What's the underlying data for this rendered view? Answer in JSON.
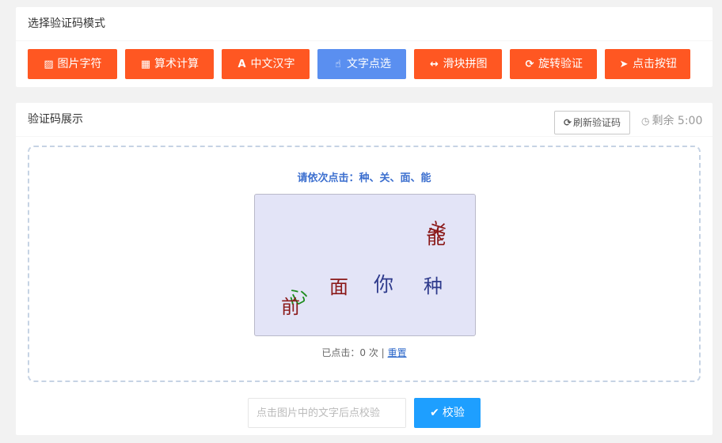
{
  "mode_card": {
    "title": "选择验证码模式",
    "buttons": [
      {
        "label": "图片字符",
        "icon": "image-icon",
        "glyph": "▨",
        "active": false
      },
      {
        "label": "算术计算",
        "icon": "calculator-icon",
        "glyph": "▦",
        "active": false
      },
      {
        "label": "中文汉字",
        "icon": "font-icon",
        "glyph": "A",
        "active": false
      },
      {
        "label": "文字点选",
        "icon": "hand-pointer-icon",
        "glyph": "☝",
        "active": true
      },
      {
        "label": "滑块拼图",
        "icon": "arrows-horizontal-icon",
        "glyph": "↔",
        "active": false
      },
      {
        "label": "旋转验证",
        "icon": "rotate-icon",
        "glyph": "⟳",
        "active": false
      },
      {
        "label": "点击按钮",
        "icon": "cursor-icon",
        "glyph": "➤",
        "active": false
      }
    ],
    "colors": {
      "default": "#ff5722",
      "active": "#5a8ff0"
    }
  },
  "show_card": {
    "title": "验证码展示",
    "refresh_label": "刷新验证码",
    "refresh_glyph": "⟳",
    "timer_glyph": "◷",
    "timer_text": "剩余 5:00",
    "prompt": "请依次点击：种、关、面、能",
    "captcha_chars": [
      {
        "char": "关",
        "color": "#8b1a1a",
        "name": "captcha-char-guan"
      },
      {
        "char": "能",
        "color": "#8b1a1a",
        "name": "captcha-char-neng"
      },
      {
        "char": "面",
        "color": "#8b1a1a",
        "name": "captcha-char-mian"
      },
      {
        "char": "你",
        "color": "#2e3a8c",
        "name": "captcha-char-ni"
      },
      {
        "char": "种",
        "color": "#2e3a8c",
        "name": "captcha-char-zhong"
      },
      {
        "char": "心",
        "color": "#1e8c1e",
        "name": "captcha-char-xin"
      },
      {
        "char": "前",
        "color": "#8b1a1a",
        "name": "captcha-char-qian"
      }
    ],
    "click_count_text": "已点击：0 次 |",
    "reset_label": "重置",
    "input_placeholder": "点击图片中的文字后点校验",
    "input_value": "",
    "verify_label": "校验",
    "verify_glyph": "✔"
  }
}
